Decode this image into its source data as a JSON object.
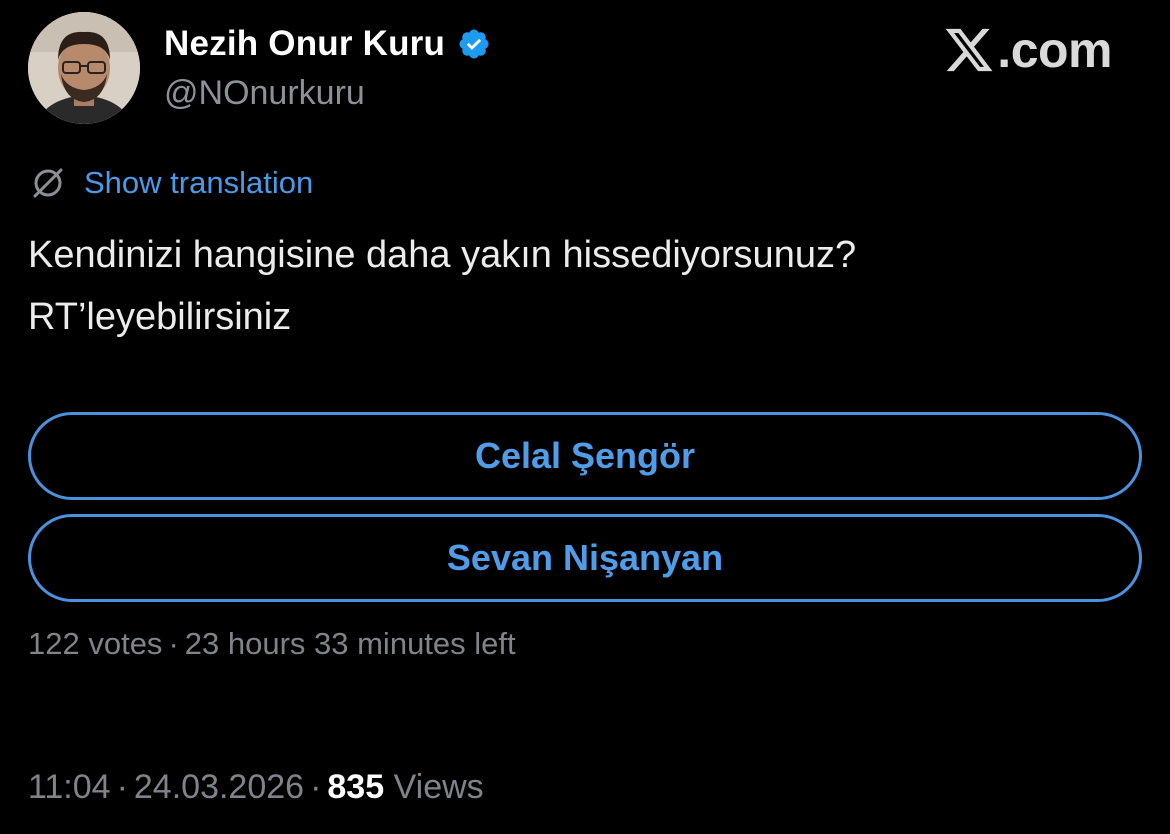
{
  "author": {
    "display_name": "Nezih Onur Kuru",
    "handle": "@NOnurkuru",
    "verified_icon": "verified-badge-icon"
  },
  "brand": {
    "text": ".com",
    "icon": "x-logo-icon"
  },
  "translation": {
    "label": "Show translation",
    "icon": "globe-slash-icon"
  },
  "tweet": {
    "lines": [
      "Kendinizi hangisine daha yakın hissediyorsunuz?",
      "RT’leyebilirsiniz"
    ]
  },
  "poll": {
    "options": [
      {
        "label": "Celal Şengör"
      },
      {
        "label": "Sevan Nişanyan"
      }
    ],
    "votes": "122 votes",
    "separator": "·",
    "time_left": "23 hours 33 minutes left"
  },
  "meta": {
    "time": "11:04",
    "separator": "·",
    "date": "24.03.2026",
    "views_count": "835",
    "views_label": "Views"
  },
  "colors": {
    "background": "#000000",
    "accent": "#4a92dd",
    "muted": "#7e848a",
    "verified": "#1d9bf0"
  }
}
